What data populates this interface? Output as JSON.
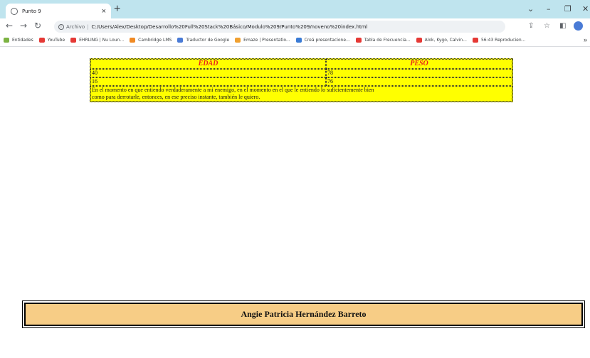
{
  "browser": {
    "tab_title": "Punto 9",
    "tab_close": "×",
    "new_tab": "+",
    "window_controls": [
      "⌄",
      "–",
      "❐",
      "✕"
    ],
    "address": {
      "scheme_label": "Archivo",
      "url": "C:/Users/Alex/Desktop/Desarrollo%20Full%20Stack%20Básico/Modulo%209/Punto%209/noveno%20index.html"
    },
    "bookmarks": [
      {
        "label": "Entidades",
        "color": "#7cb342"
      },
      {
        "label": "YouTube",
        "color": "#e53935"
      },
      {
        "label": "EHRLING | Nu Loun...",
        "color": "#e53935"
      },
      {
        "label": "Cambridge LMS",
        "color": "#f08a24"
      },
      {
        "label": "Traductor de Google",
        "color": "#4a7bd6"
      },
      {
        "label": "Emaze | Presentatio...",
        "color": "#f0a030"
      },
      {
        "label": "Creá presentacione...",
        "color": "#3a7bd5"
      },
      {
        "label": "Tabla de Frecuencia...",
        "color": "#e53935"
      },
      {
        "label": "Alok, Kygo, Calvin...",
        "color": "#e53935"
      },
      {
        "label": "56:43 Reproducien...",
        "color": "#e53935"
      }
    ],
    "bookmarks_more": "»"
  },
  "table": {
    "headers": [
      "EDAD",
      "PESO"
    ],
    "rows": [
      [
        "40",
        "78"
      ],
      [
        "16",
        "76"
      ]
    ],
    "quote_line1": "En el momento en que entiendo verdaderamente a mi enemigo, en el momento en el que le entiendo lo suficientemente bien",
    "quote_line2": "como para derrotarle, entonces, en ese preciso instante, también le quiero."
  },
  "footer": {
    "author": "Angie Patricia Hernández Barreto"
  },
  "colors": {
    "table_bg": "#ffff00",
    "header_text": "#e8231b",
    "footer_bg": "#f7cd86"
  }
}
